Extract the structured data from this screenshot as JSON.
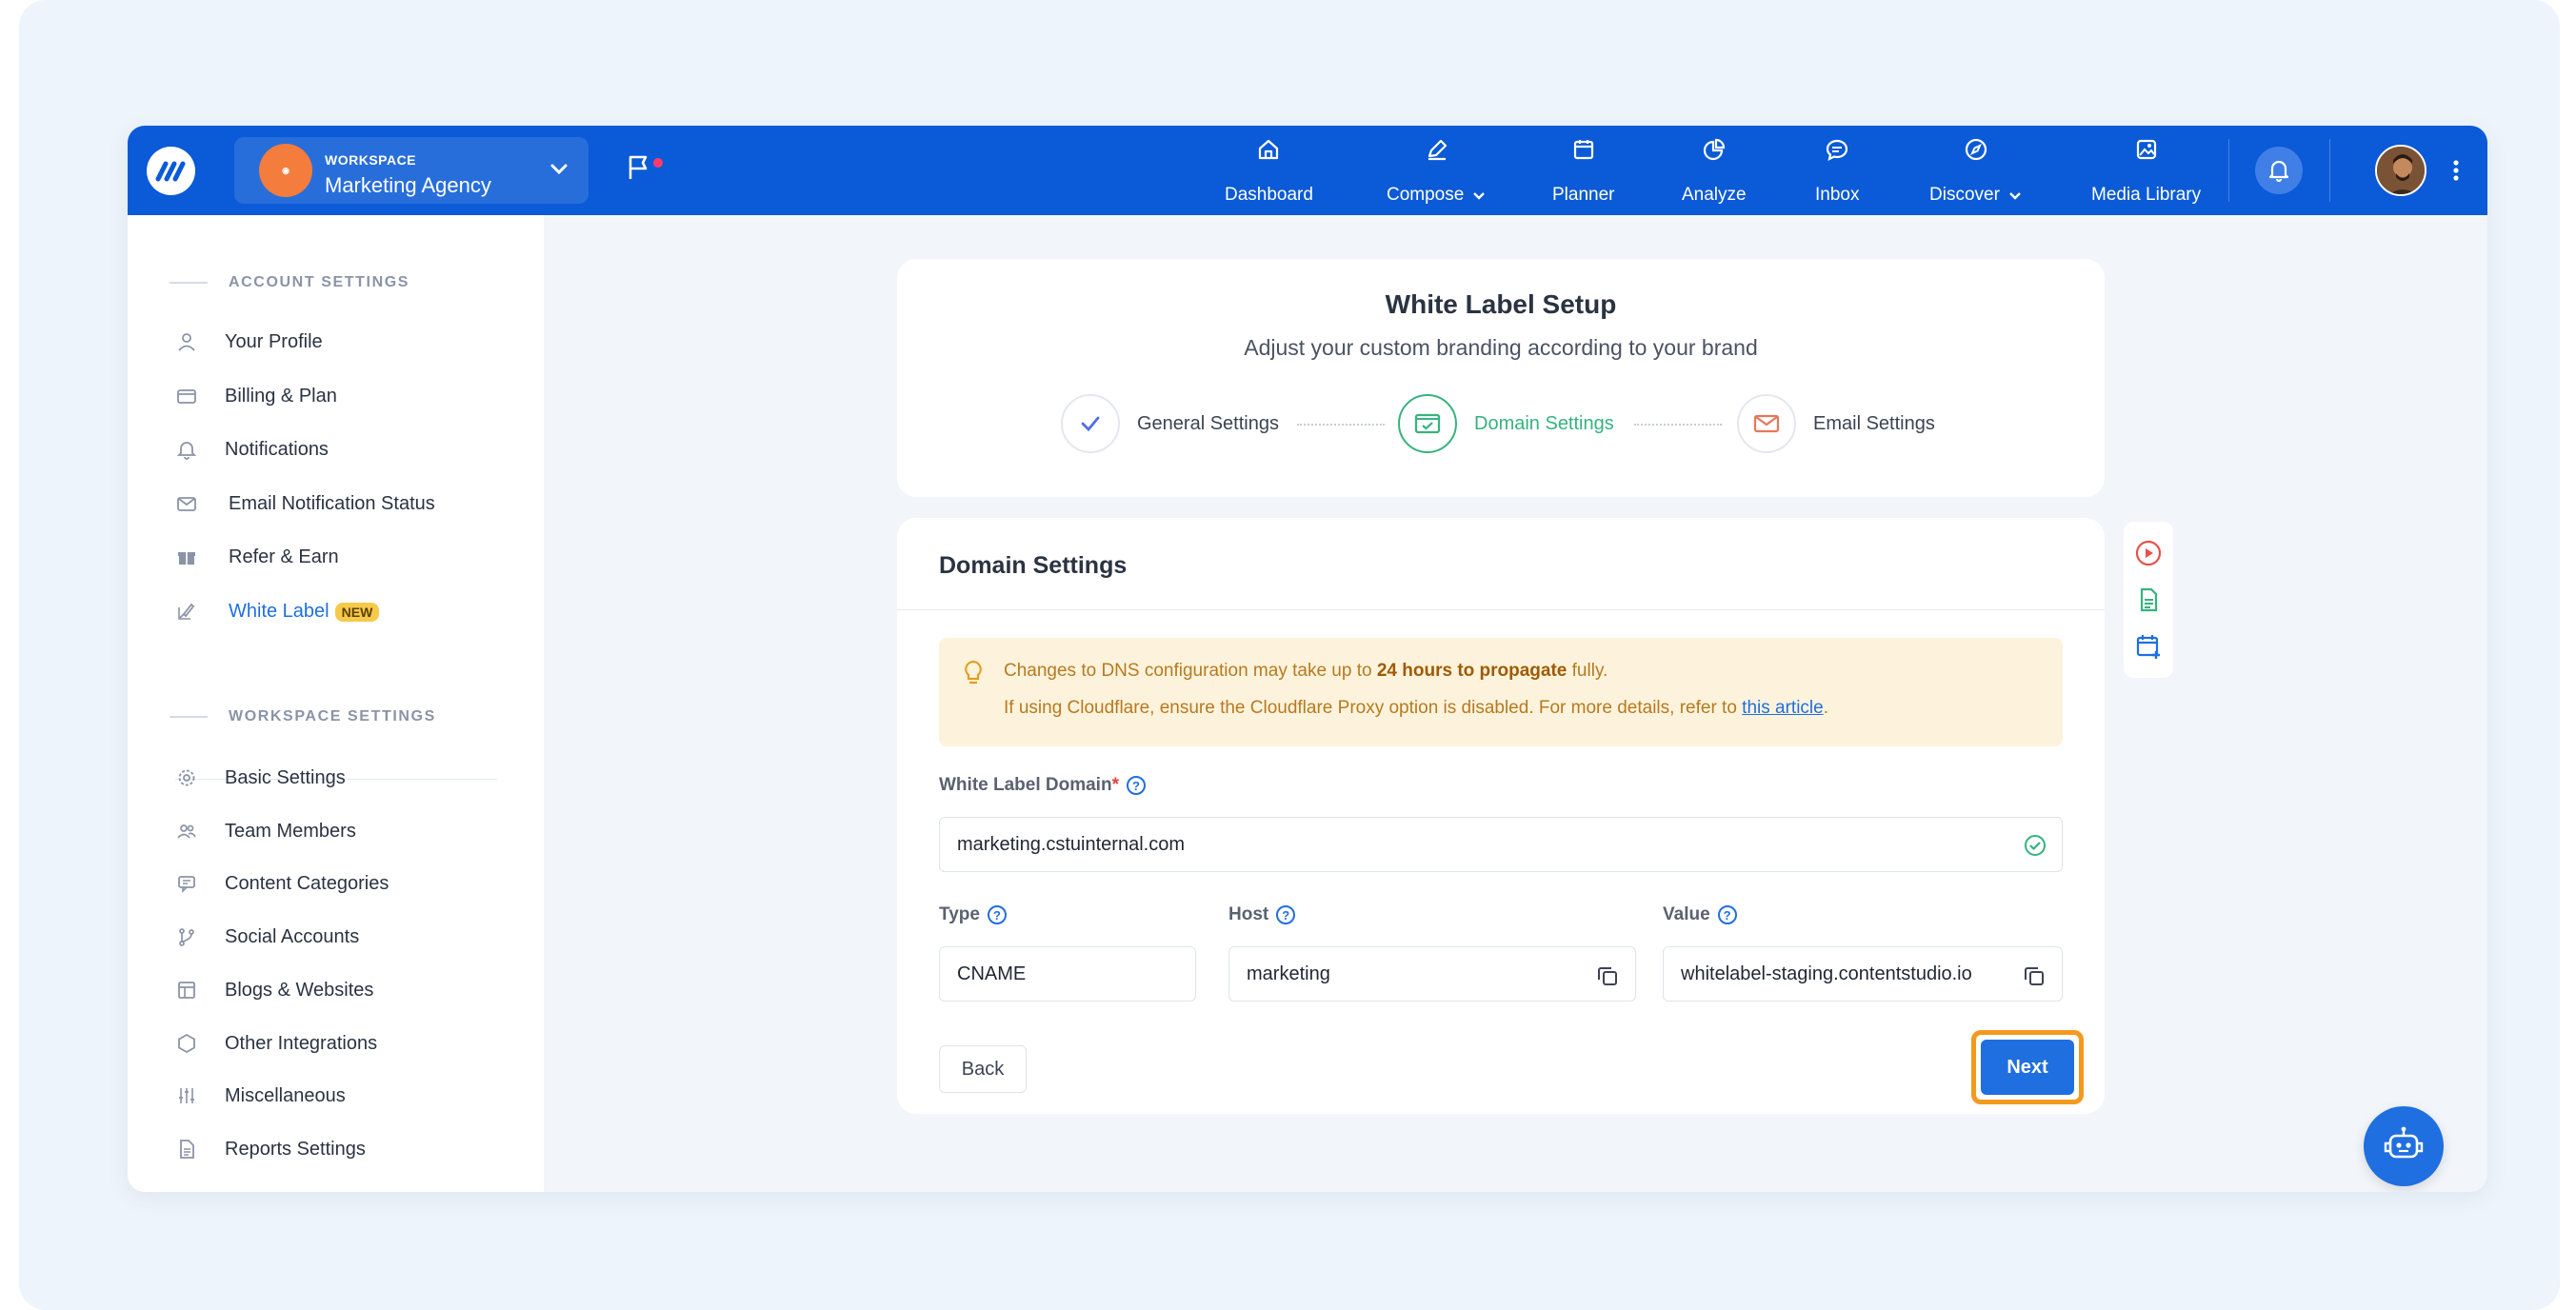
{
  "workspace": {
    "label": "WORKSPACE",
    "name": "Marketing Agency"
  },
  "nav": {
    "dashboard": "Dashboard",
    "compose": "Compose",
    "planner": "Planner",
    "analyze": "Analyze",
    "inbox": "Inbox",
    "discover": "Discover",
    "media_library": "Media Library"
  },
  "sidebar": {
    "account_title": "ACCOUNT SETTINGS",
    "account_items": [
      {
        "label": "Your Profile",
        "icon": "user-icon"
      },
      {
        "label": "Billing & Plan",
        "icon": "card-icon"
      },
      {
        "label": "Notifications",
        "icon": "bell-icon"
      },
      {
        "label": "Email Notification Status",
        "icon": "mail-icon"
      },
      {
        "label": "Refer & Earn",
        "icon": "gift-icon"
      },
      {
        "label": "White Label",
        "icon": "brush-icon",
        "badge": "NEW"
      }
    ],
    "workspace_title": "WORKSPACE SETTINGS",
    "workspace_items": [
      {
        "label": "Basic Settings",
        "icon": "gear-icon"
      },
      {
        "label": "Team Members",
        "icon": "users-icon"
      },
      {
        "label": "Content Categories",
        "icon": "category-icon"
      },
      {
        "label": "Social Accounts",
        "icon": "branch-icon"
      },
      {
        "label": "Blogs & Websites",
        "icon": "layout-icon"
      },
      {
        "label": "Other Integrations",
        "icon": "hexagon-icon"
      },
      {
        "label": "Miscellaneous",
        "icon": "sliders-icon"
      },
      {
        "label": "Reports Settings",
        "icon": "file-icon"
      }
    ]
  },
  "setup": {
    "title": "White Label Setup",
    "subtitle": "Adjust your custom branding according to your brand",
    "steps": [
      "General Settings",
      "Domain Settings",
      "Email Settings"
    ]
  },
  "domain": {
    "title": "Domain Settings",
    "alert_prefix": "Changes to DNS configuration may take up to ",
    "alert_bold": "24 hours to propagate",
    "alert_suffix": " fully.",
    "alert_line2": "If using Cloudflare, ensure the Cloudflare Proxy option is disabled. For more details, refer to ",
    "alert_link": "this article",
    "alert_end": ".",
    "wl_domain_label": "White Label Domain",
    "wl_domain_required": "*",
    "wl_domain_value": "marketing.cstuinternal.com",
    "type_label": "Type",
    "type_value": "CNAME",
    "host_label": "Host",
    "host_value": "marketing",
    "value_label": "Value",
    "value_value": "whitelabel-staging.contentstudio.io",
    "back": "Back",
    "next": "Next"
  },
  "help_fab": "?",
  "colors": {
    "primary": "#0b5ad7",
    "accent": "#1f6fe0",
    "success": "#36b37e",
    "highlight": "#f39a1e"
  }
}
